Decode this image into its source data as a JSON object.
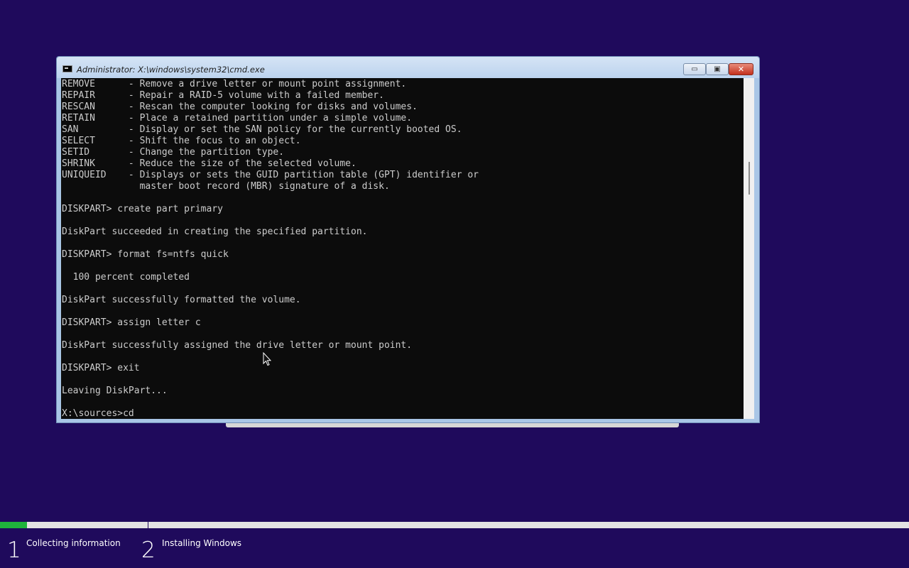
{
  "window": {
    "title": "Administrator: X:\\windows\\system32\\cmd.exe",
    "buttons": {
      "minimize": "▭",
      "maximize": "▣",
      "close": "✕"
    }
  },
  "console": {
    "lines": [
      "REMOVE      - Remove a drive letter or mount point assignment.",
      "REPAIR      - Repair a RAID-5 volume with a failed member.",
      "RESCAN      - Rescan the computer looking for disks and volumes.",
      "RETAIN      - Place a retained partition under a simple volume.",
      "SAN         - Display or set the SAN policy for the currently booted OS.",
      "SELECT      - Shift the focus to an object.",
      "SETID       - Change the partition type.",
      "SHRINK      - Reduce the size of the selected volume.",
      "UNIQUEID    - Displays or sets the GUID partition table (GPT) identifier or",
      "              master boot record (MBR) signature of a disk.",
      "",
      "DISKPART> create part primary",
      "",
      "DiskPart succeeded in creating the specified partition.",
      "",
      "DISKPART> format fs=ntfs quick",
      "",
      "  100 percent completed",
      "",
      "DiskPart successfully formatted the volume.",
      "",
      "DISKPART> assign letter c",
      "",
      "DiskPart successfully assigned the drive letter or mount point.",
      "",
      "DISKPART> exit",
      "",
      "Leaving DiskPart...",
      "",
      "X:\\sources>cd"
    ]
  },
  "setup": {
    "progress": 0.03,
    "steps": [
      {
        "number": "1",
        "label": "Collecting information"
      },
      {
        "number": "2",
        "label": "Installing Windows"
      }
    ]
  },
  "icons": {
    "window": "cmd-icon",
    "cursor": "mouse-cursor-icon"
  }
}
